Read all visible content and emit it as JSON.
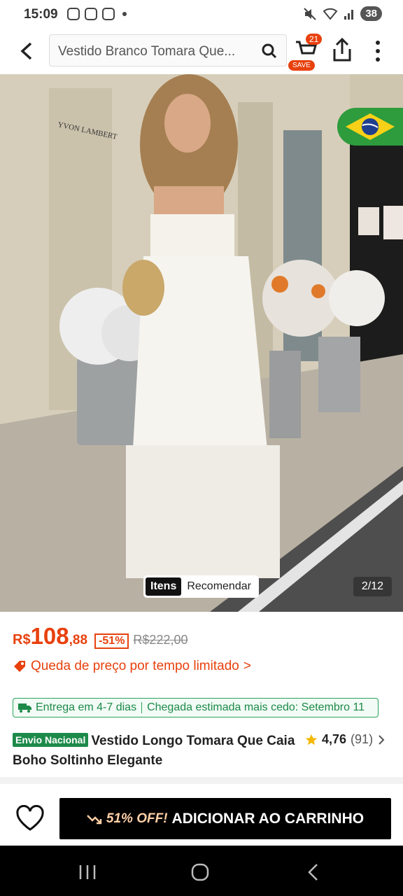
{
  "status_bar": {
    "time": "15:09",
    "battery": "38"
  },
  "search": {
    "query": "Vestido Branco Tomara Que..."
  },
  "cart": {
    "count": "21",
    "save_label": "SAVE"
  },
  "gallery": {
    "tabs": [
      "Itens",
      "Recomendar"
    ],
    "counter": "2/12",
    "signage": "YVON LAMBERT"
  },
  "price": {
    "currency": "R$",
    "whole": "108",
    "cents": ",88",
    "discount": "-51%",
    "original": "R$222,00"
  },
  "promo": {
    "text": "Queda de preço por tempo limitado",
    "chevron": ">"
  },
  "shipping": {
    "delivery": "Entrega em 4-7 dias",
    "estimate": "Chegada estimada mais cedo: Setembro 11"
  },
  "product": {
    "badge": "Envio Nacional",
    "title": "Vestido Longo Tomara Que Caia Boho Soltinho Elegante"
  },
  "rating": {
    "value": "4,76",
    "count": "(91)"
  },
  "bottom": {
    "discount_label": "51% OFF!",
    "add_label": "ADICIONAR AO CARRINHO"
  },
  "colors": {
    "accent": "#e8410e",
    "green": "#1d8a4a",
    "button": "#000000"
  }
}
